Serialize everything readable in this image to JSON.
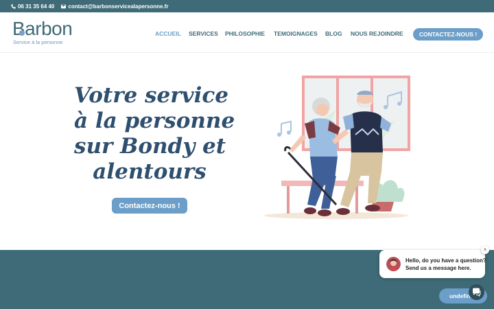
{
  "topbar": {
    "phone": "06 31 35 64 40",
    "email": "contact@barbonservicealapersonne.fr"
  },
  "logo": {
    "name": "Barbon",
    "tagline": "Service à la personne"
  },
  "nav": {
    "items": [
      {
        "label": "ACCUEIL",
        "active": true
      },
      {
        "label": "SERVICES",
        "active": false
      },
      {
        "label": "PHILOSOPHIE",
        "active": false
      },
      {
        "label": "TEMOIGNAGES",
        "active": false
      },
      {
        "label": "BLOG",
        "active": false
      },
      {
        "label": "NOUS REJOINDRE",
        "active": false
      }
    ],
    "cta": "CONTACTEZ-NOUS !"
  },
  "hero": {
    "title_lines": [
      "Votre service",
      "à la personne",
      "sur Bondy et",
      "alentours"
    ],
    "cta": "Contactez-nous !"
  },
  "chat": {
    "line1": "Hello, do you have a question?",
    "line2": "Send us a message here.",
    "launcher": "undefined",
    "close": "×"
  },
  "colors": {
    "brand_teal": "#3e6b77",
    "accent_blue": "#6b9ec8",
    "title_navy": "#2f4f6f"
  }
}
